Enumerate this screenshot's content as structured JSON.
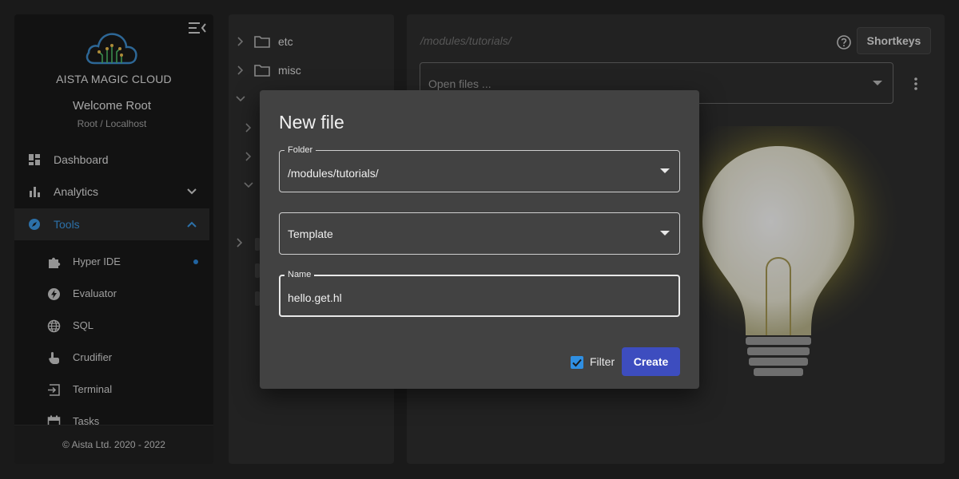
{
  "sidebar": {
    "brand": "AISTA MAGIC CLOUD",
    "welcome": "Welcome Root",
    "role": "Root / Localhost",
    "nav": [
      {
        "label": "Dashboard",
        "icon": "dashboard-icon"
      },
      {
        "label": "Analytics",
        "icon": "bar-chart-icon"
      },
      {
        "label": "Tools",
        "icon": "explore-icon",
        "active": true
      }
    ],
    "tools": [
      {
        "label": "Hyper IDE",
        "icon": "puzzle-icon",
        "indicator": true
      },
      {
        "label": "Evaluator",
        "icon": "bolt-icon"
      },
      {
        "label": "SQL",
        "icon": "globe-icon"
      },
      {
        "label": "Crudifier",
        "icon": "touch-icon"
      },
      {
        "label": "Terminal",
        "icon": "terminal-icon"
      },
      {
        "label": "Tasks",
        "icon": "calendar-icon"
      }
    ],
    "footer": "© Aista Ltd. 2020 - 2022"
  },
  "explorer": {
    "folders": [
      {
        "label": "etc",
        "icon": "folder-icon"
      },
      {
        "label": "misc",
        "icon": "folder-icon"
      }
    ]
  },
  "editor": {
    "path": "/modules/tutorials/",
    "shortkeys_label": "Shortkeys",
    "open_files_placeholder": "Open files ..."
  },
  "dialog": {
    "title": "New file",
    "folder_label": "Folder",
    "folder_value": "/modules/tutorials/",
    "template_value": "Template",
    "name_label": "Name",
    "name_value": "hello.get.hl",
    "filter_label": "Filter",
    "filter_checked": true,
    "create_label": "Create"
  },
  "colors": {
    "accent": "#3d9be9",
    "primary_button": "#3d4dbf",
    "checkbox": "#2f8fe2",
    "background": "#252525"
  }
}
